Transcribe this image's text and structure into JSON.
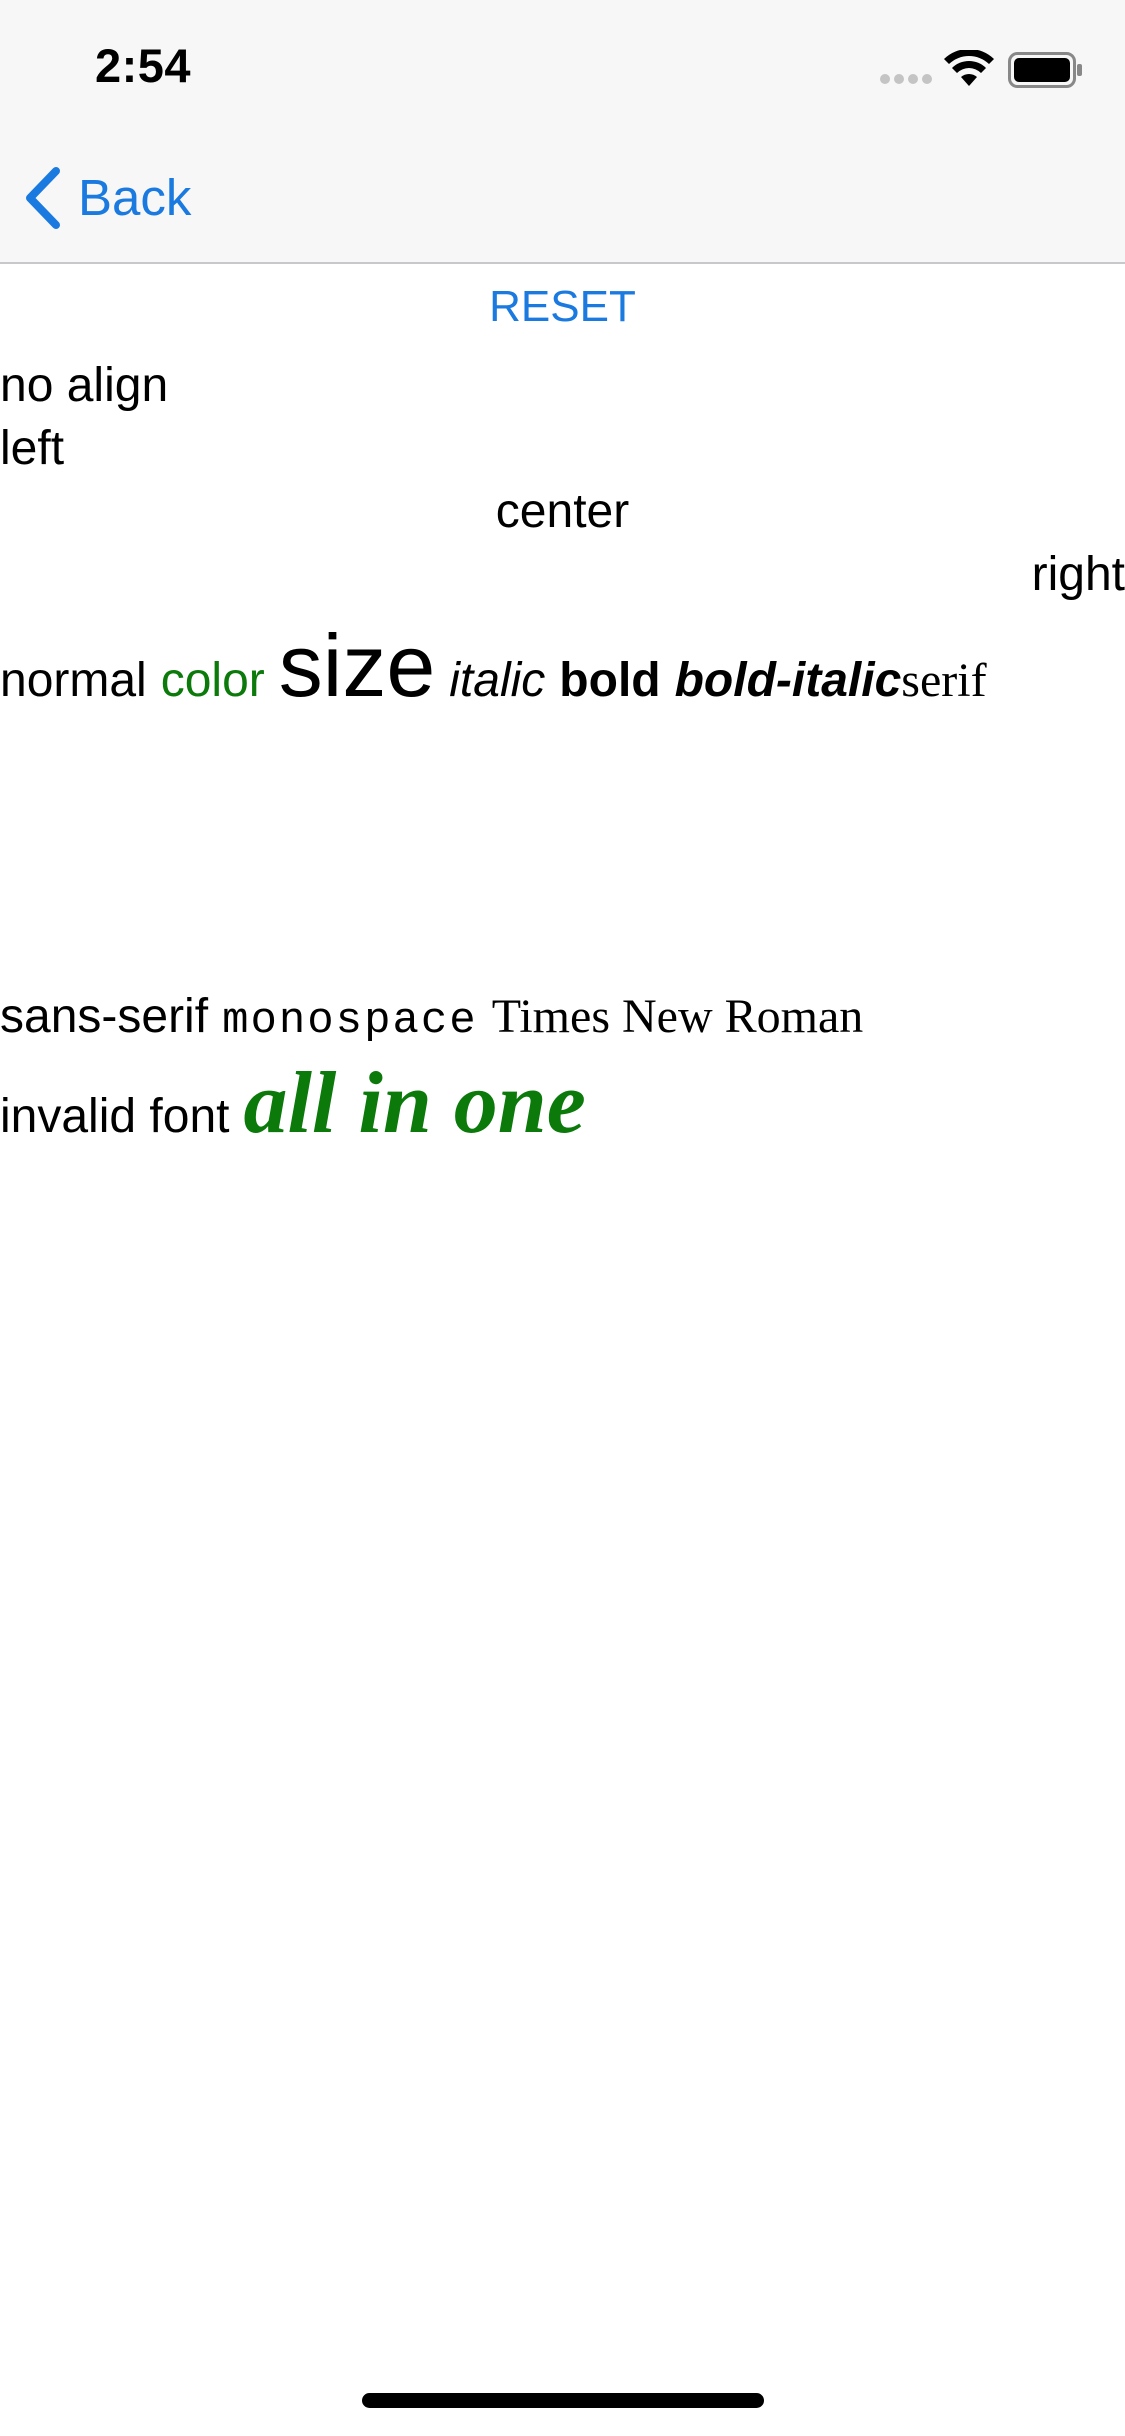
{
  "status_bar": {
    "time": "2:54"
  },
  "nav": {
    "back_label": "Back"
  },
  "content": {
    "reset_label": "RESET",
    "alignment_lines": {
      "no_align": "no align",
      "left": "left",
      "center": "center",
      "right": "right"
    },
    "style_row": {
      "normal": "normal",
      "color": "color",
      "size": "size",
      "italic": "italic",
      "bold": "bold",
      "bold_italic": "bold-italic",
      "serif": "serif"
    },
    "font_row": {
      "sans_serif": "sans-serif",
      "monospace": "monospace",
      "times_new_roman": "Times New Roman"
    },
    "invalid_row": {
      "invalid_font": "invalid font",
      "all_in_one": "all in one"
    }
  },
  "colors": {
    "accent": "#1a7ae0",
    "green_text": "#0b7a0b",
    "bar_background": "#f7f7f7"
  }
}
